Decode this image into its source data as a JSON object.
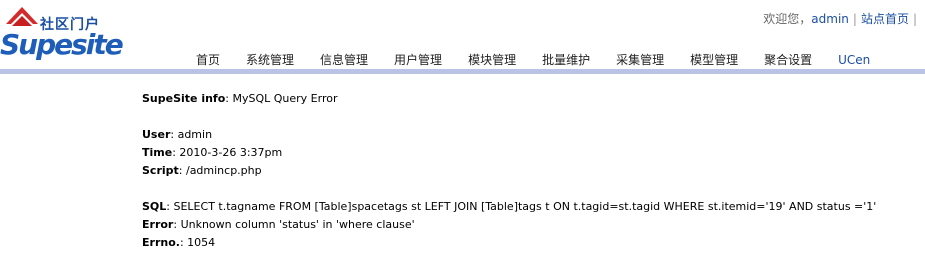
{
  "brand": {
    "cn_name": "社区门户",
    "en_name": "Supesite"
  },
  "toplinks": {
    "welcome": "欢迎您，",
    "user": "admin",
    "site_home": "站点首页"
  },
  "nav": {
    "items": [
      "首页",
      "系统管理",
      "信息管理",
      "用户管理",
      "模块管理",
      "批量维护",
      "采集管理",
      "模型管理",
      "聚合设置",
      "UCen"
    ]
  },
  "error": {
    "header_label": "SupeSite info",
    "header_value": "MySQL Query Error",
    "user_label": "User",
    "user_value": "admin",
    "time_label": "Time",
    "time_value": "2010-3-26 3:37pm",
    "script_label": "Script",
    "script_value": "/admincp.php",
    "sql_label": "SQL",
    "sql_value": "SELECT t.tagname FROM [Table]spacetags st LEFT JOIN [Table]tags t ON t.tagid=st.tagid WHERE st.itemid='19' AND status ='1'",
    "error_label": "Error",
    "error_value": "Unknown column 'status' in 'where clause'",
    "errno_label": "Errno.",
    "errno_value": "1054"
  }
}
